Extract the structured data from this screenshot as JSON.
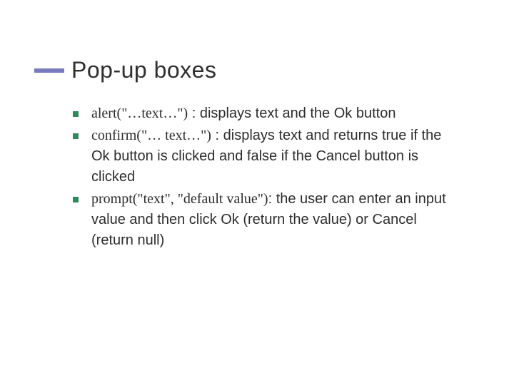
{
  "slide": {
    "title": "Pop-up boxes",
    "bullets": [
      {
        "code": "alert(\"…text…\")",
        "desc": " : displays text and the Ok button"
      },
      {
        "code": "confirm(\"… text…\")",
        "desc": " : displays text and returns true if the Ok button is clicked and false if the Cancel button is clicked"
      },
      {
        "code": "prompt(\"text\", \"default value\")",
        "desc": ": the user can enter an input value and then click Ok (return the value) or Cancel (return null)"
      }
    ]
  }
}
